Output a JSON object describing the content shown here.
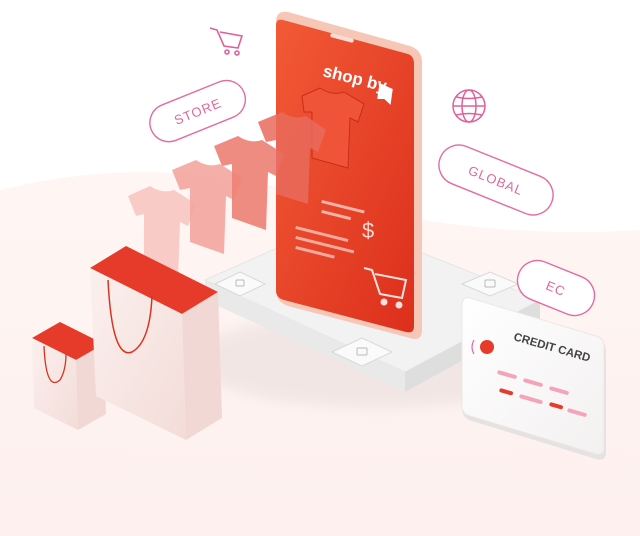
{
  "brand": {
    "logo_text": "shop by"
  },
  "tags": {
    "store": "STORE",
    "global": "GLOBAL",
    "ec": "EC"
  },
  "card": {
    "title": "CREDIT CARD"
  },
  "phone": {
    "currency_symbol": "$"
  },
  "colors": {
    "accent": "#f04a2c",
    "accent_dark": "#d9331f",
    "pill_stroke": "#e56aa0",
    "pill_text": "#e06898",
    "shirt_1": "#f7c7c2",
    "shirt_2": "#f3a69f",
    "shirt_3": "#ee8277",
    "bag_red": "#e63b2a",
    "bg_wave": "#fdf1ef"
  },
  "icons": {
    "cart_top": "shopping-cart-icon",
    "globe": "globe-icon",
    "cart_phone": "shopping-cart-icon",
    "chip": "card-chip-icon",
    "contactless": "contactless-icon"
  }
}
